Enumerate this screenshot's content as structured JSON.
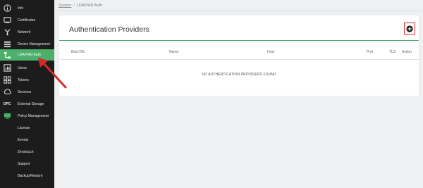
{
  "sidebar": {
    "items": [
      {
        "label": "Info",
        "icon": "info-icon"
      },
      {
        "label": "Certificates",
        "icon": "certificate-icon"
      },
      {
        "label": "Network",
        "icon": "network-icon"
      },
      {
        "label": "Device Management",
        "icon": "device-management-icon"
      },
      {
        "label": "LDAP/AD Auth",
        "icon": "ldap-auth-icon",
        "active": true
      },
      {
        "label": "Users",
        "icon": "users-icon"
      },
      {
        "label": "Tokens",
        "icon": "tokens-icon"
      },
      {
        "label": "Services",
        "icon": "services-icon"
      },
      {
        "label": "External Storage",
        "icon": "opc-icon",
        "icon_text": "OPC"
      },
      {
        "label": "Policy Management",
        "icon": "policy-icon"
      },
      {
        "label": "License",
        "icon": ""
      },
      {
        "label": "Events",
        "icon": ""
      },
      {
        "label": "Zerotouch",
        "icon": ""
      },
      {
        "label": "Support",
        "icon": ""
      },
      {
        "label": "Backup/Restore",
        "icon": ""
      }
    ]
  },
  "breadcrumb": {
    "parent": "System",
    "current": "LDAP/AD Auth"
  },
  "card": {
    "title": "Authentication Providers",
    "columns": [
      "Bind DN",
      "Name",
      "Host",
      "Port",
      "TLS",
      "Action"
    ],
    "empty_message": "NO AUTHENTICATION PROVIDERS FOUND"
  },
  "colors": {
    "sidebar_bg": "#1c1c1c",
    "accent": "#4caf6a",
    "annotation": "#d42a2a"
  }
}
